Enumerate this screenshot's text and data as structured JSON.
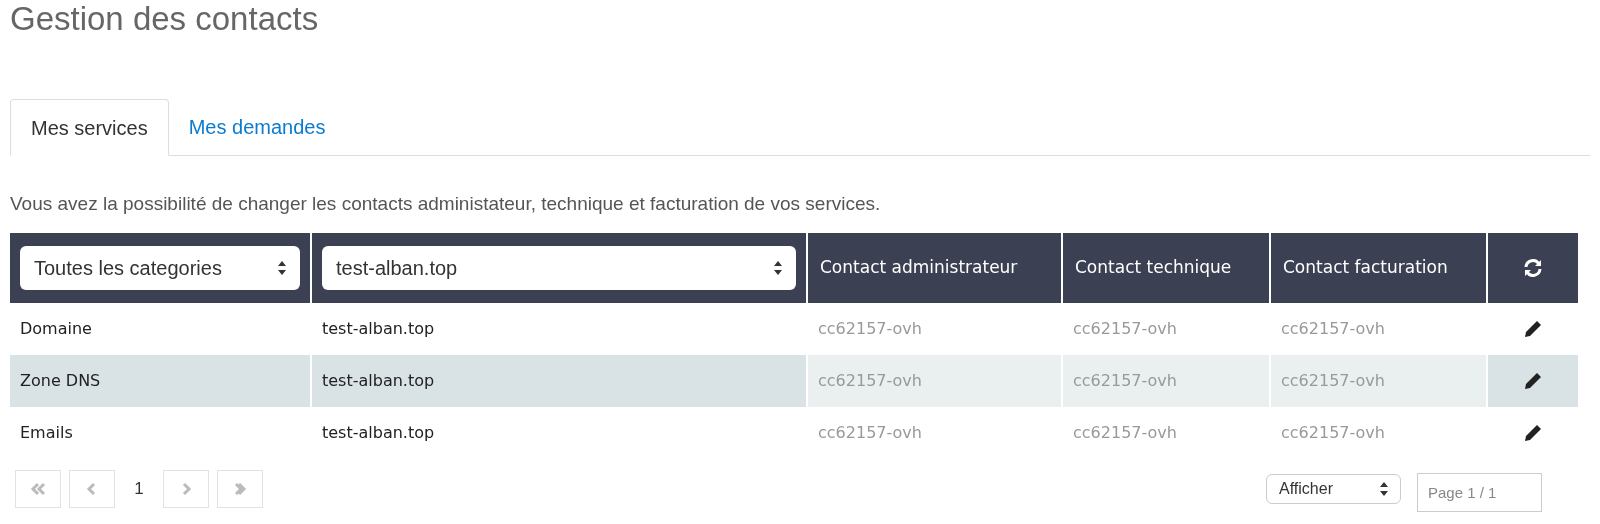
{
  "title": "Gestion des contacts",
  "tabs": [
    {
      "label": "Mes services",
      "selected": true
    },
    {
      "label": "Mes demandes",
      "selected": false
    }
  ],
  "description": "Vous avez la possibilité de changer les contacts administateur, technique et facturation de vos services.",
  "table": {
    "filters": [
      {
        "value": "Toutes les categories"
      },
      {
        "value": "test-alban.top"
      }
    ],
    "columns": [
      "Contact administrateur",
      "Contact technique",
      "Contact facturation"
    ],
    "rows": [
      {
        "category": "Domaine",
        "service": "test-alban.top",
        "admin": "cc62157-ovh",
        "tech": "cc62157-ovh",
        "billing": "cc62157-ovh",
        "selected": false
      },
      {
        "category": "Zone DNS",
        "service": "test-alban.top",
        "admin": "cc62157-ovh",
        "tech": "cc62157-ovh",
        "billing": "cc62157-ovh",
        "selected": true
      },
      {
        "category": "Emails",
        "service": "test-alban.top",
        "admin": "cc62157-ovh",
        "tech": "cc62157-ovh",
        "billing": "cc62157-ovh",
        "selected": false
      }
    ]
  },
  "pagination": {
    "page": "1",
    "page_size": {
      "value": "Afficher"
    },
    "page_field": {
      "placeholder": "Page 1 / 1"
    }
  }
}
